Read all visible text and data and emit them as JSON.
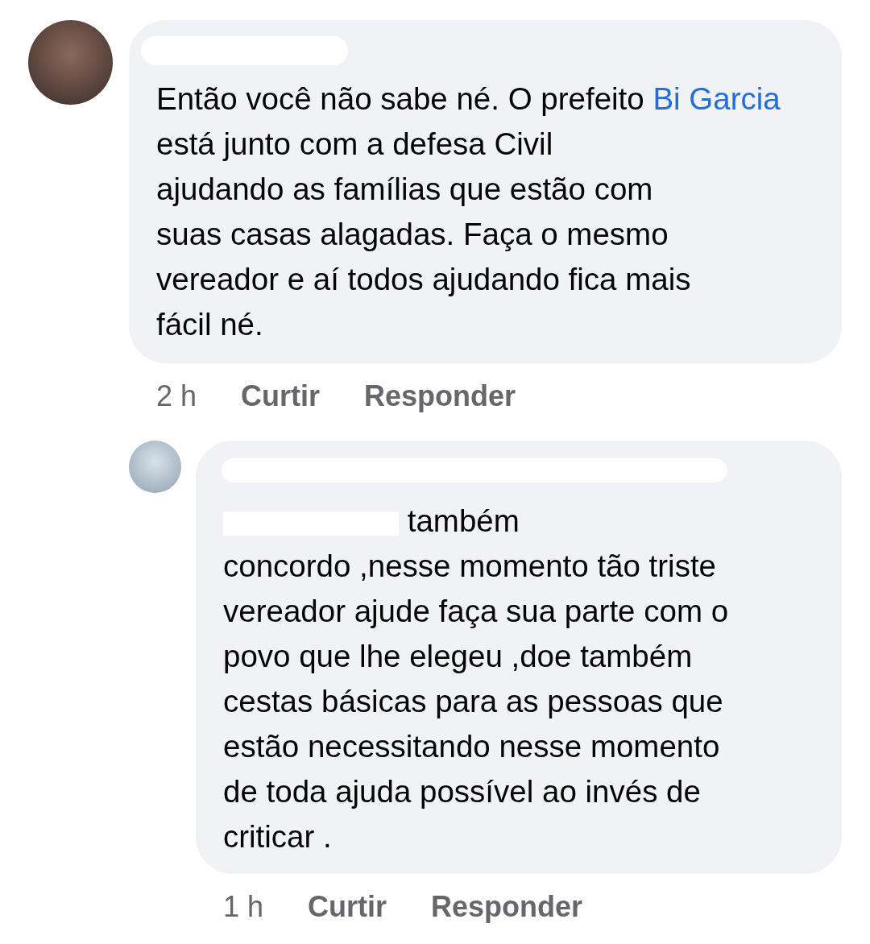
{
  "comments": [
    {
      "kind": "comment",
      "text_before": "Então você não sabe né. O prefeito",
      "link": "Bi Garcia",
      "text_after": " está junto com a defesa Civil\najudando as famílias que estão com\nsuas casas alagadas. Faça o mesmo\nvereador e aí todos ajudando fica mais\nfácil né.",
      "time": "2 h",
      "actions": [
        "Curtir",
        "Responder"
      ]
    },
    {
      "kind": "reply",
      "text_after": " também\nconcordo ,nesse momento tão triste\nvereador ajude faça sua parte com o\npovo que lhe elegeu ,doe também\ncestas básicas para as pessoas que\nestão necessitando nesse momento\nde toda ajuda possível ao invés de\ncriticar .",
      "time": "1 h",
      "actions": [
        "Curtir",
        "Responder"
      ]
    }
  ]
}
